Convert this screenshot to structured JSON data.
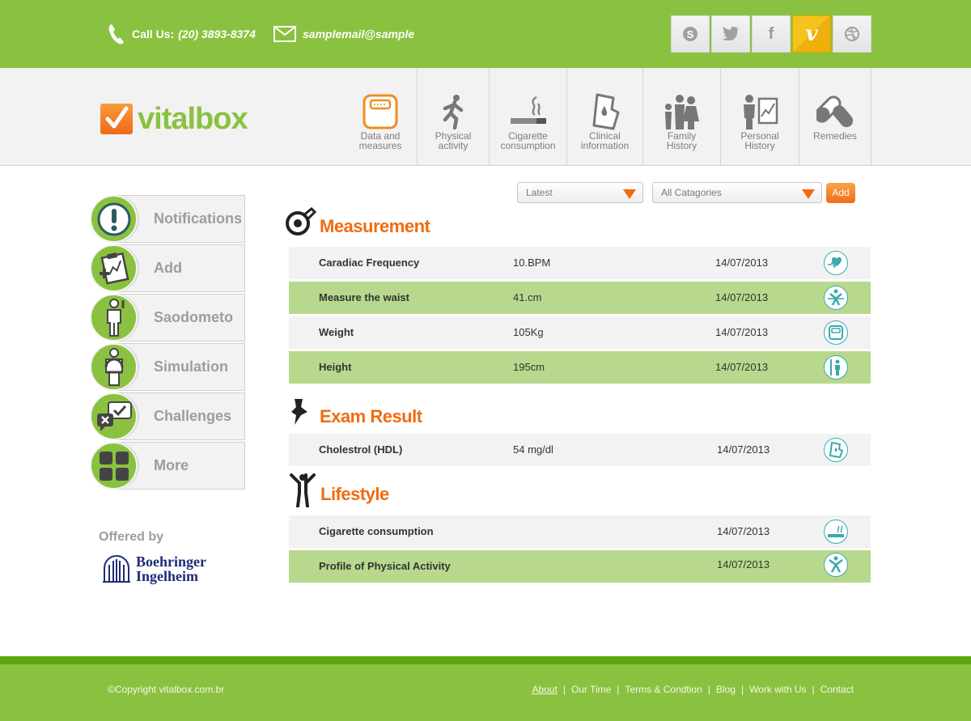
{
  "topbar": {
    "phone_label": "Call Us:",
    "phone_number": "(20) 3893-8374",
    "email": "samplemail@sample",
    "social": [
      {
        "name": "skype",
        "glyph": "S"
      },
      {
        "name": "twitter",
        "glyph": "t"
      },
      {
        "name": "facebook",
        "glyph": "f"
      },
      {
        "name": "vimeo",
        "glyph": "v"
      },
      {
        "name": "dribbble",
        "glyph": "◎"
      }
    ]
  },
  "brand": {
    "name": "vitalbox",
    "accent": "#8bc140",
    "orange": "#ef6c10"
  },
  "nav": [
    {
      "label": "Data and\nmeasures",
      "icon": "scale-icon"
    },
    {
      "label": "Physical\nactivity",
      "icon": "running-icon"
    },
    {
      "label": "Cigarette\nconsumption",
      "icon": "cigarette-icon"
    },
    {
      "label": "Clinical\ninformation",
      "icon": "clinical-icon"
    },
    {
      "label": "Family\nHistory",
      "icon": "family-icon"
    },
    {
      "label": "Personal\nHistory",
      "icon": "personal-history-icon"
    },
    {
      "label": "Remedies",
      "icon": "pills-icon"
    }
  ],
  "sidebar": {
    "items": [
      {
        "label": "Notifications"
      },
      {
        "label": "Add"
      },
      {
        "label": "Saodometo"
      },
      {
        "label": "Simulation"
      },
      {
        "label": "Challenges"
      },
      {
        "label": "More"
      }
    ],
    "offered_by": "Offered by",
    "partner": [
      "Boehringer",
      "Ingelheim"
    ]
  },
  "filters": {
    "sort": "Latest",
    "category": "All Catagories",
    "add_label": "Add"
  },
  "sections": {
    "measurement": {
      "title": "Measurement",
      "rows": [
        {
          "name": "Caradiac Frequency",
          "value": "10.BPM",
          "date": "14/07/2013"
        },
        {
          "name": "Measure the waist",
          "value": "41.cm",
          "date": "14/07/2013"
        },
        {
          "name": "Weight",
          "value": "105Kg",
          "date": "14/07/2013"
        },
        {
          "name": "Height",
          "value": "195cm",
          "date": "14/07/2013"
        }
      ]
    },
    "exam": {
      "title": "Exam Result",
      "rows": [
        {
          "name": "Cholestrol (HDL)",
          "value": "54 mg/dl",
          "date": "14/07/2013"
        }
      ]
    },
    "lifestyle": {
      "title": "Lifestyle",
      "rows": [
        {
          "name": "Cigarette consumption",
          "value": "",
          "date": "14/07/2013"
        },
        {
          "name": "Profile of Physical Activity",
          "value": "",
          "date": "14/07/2013"
        }
      ]
    }
  },
  "footer": {
    "copyright": "©Copyright vitalbox.com.br",
    "links": [
      "About",
      "Our Time",
      "Terms & Condtion",
      "Blog",
      "Work with Us",
      "Contact"
    ]
  }
}
